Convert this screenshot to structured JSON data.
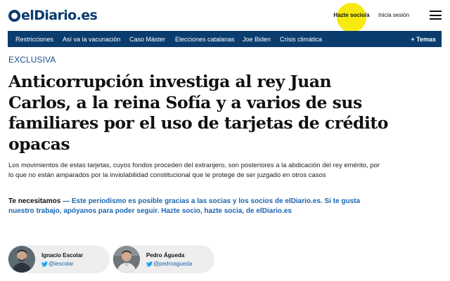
{
  "header": {
    "logo_text": "elDiario.es",
    "subscribe_label": "Hazte socio/a",
    "login_label": "Inicia sesión",
    "accent_color": "#f7ea10",
    "brand_color": "#0a3c6e"
  },
  "nav": {
    "items": [
      {
        "label": "Restricciones"
      },
      {
        "label": "Así va la vacunación"
      },
      {
        "label": "Caso Máster"
      },
      {
        "label": "Elecciones catalanas"
      },
      {
        "label": "Joe Biden"
      },
      {
        "label": "Crisis climática"
      }
    ],
    "more_label": "+ Temas"
  },
  "article": {
    "kicker": "EXCLUSIVA",
    "title": "Anticorrupción investiga al rey Juan Carlos, a la reina Sofía y a varios de sus familiares por el uso de tarjetas de crédito opacas",
    "summary": "Los movimientos de estas tarjetas, cuyos fondos proceden del extranjero, son posteriores a la abdicación del rey emérito, por lo que no están amparados por la inviolabilidad constitucional que le protege de ser juzgado en otros casos",
    "support_lead": "Te necesitamos",
    "support_body": " — Este periodismo es posible gracias a las socias y los socios de elDiario.es. Si te gusta nuestro trabajo, apóyanos para poder seguir. Hazte socio, hazte socia, de elDiario.es"
  },
  "authors": [
    {
      "name": "Ignacio Escolar",
      "handle": "@iescolar",
      "icon": "twitter-bird-icon"
    },
    {
      "name": "Pedro Águeda",
      "handle": "@pedroagueda",
      "icon": "twitter-bird-icon"
    }
  ]
}
